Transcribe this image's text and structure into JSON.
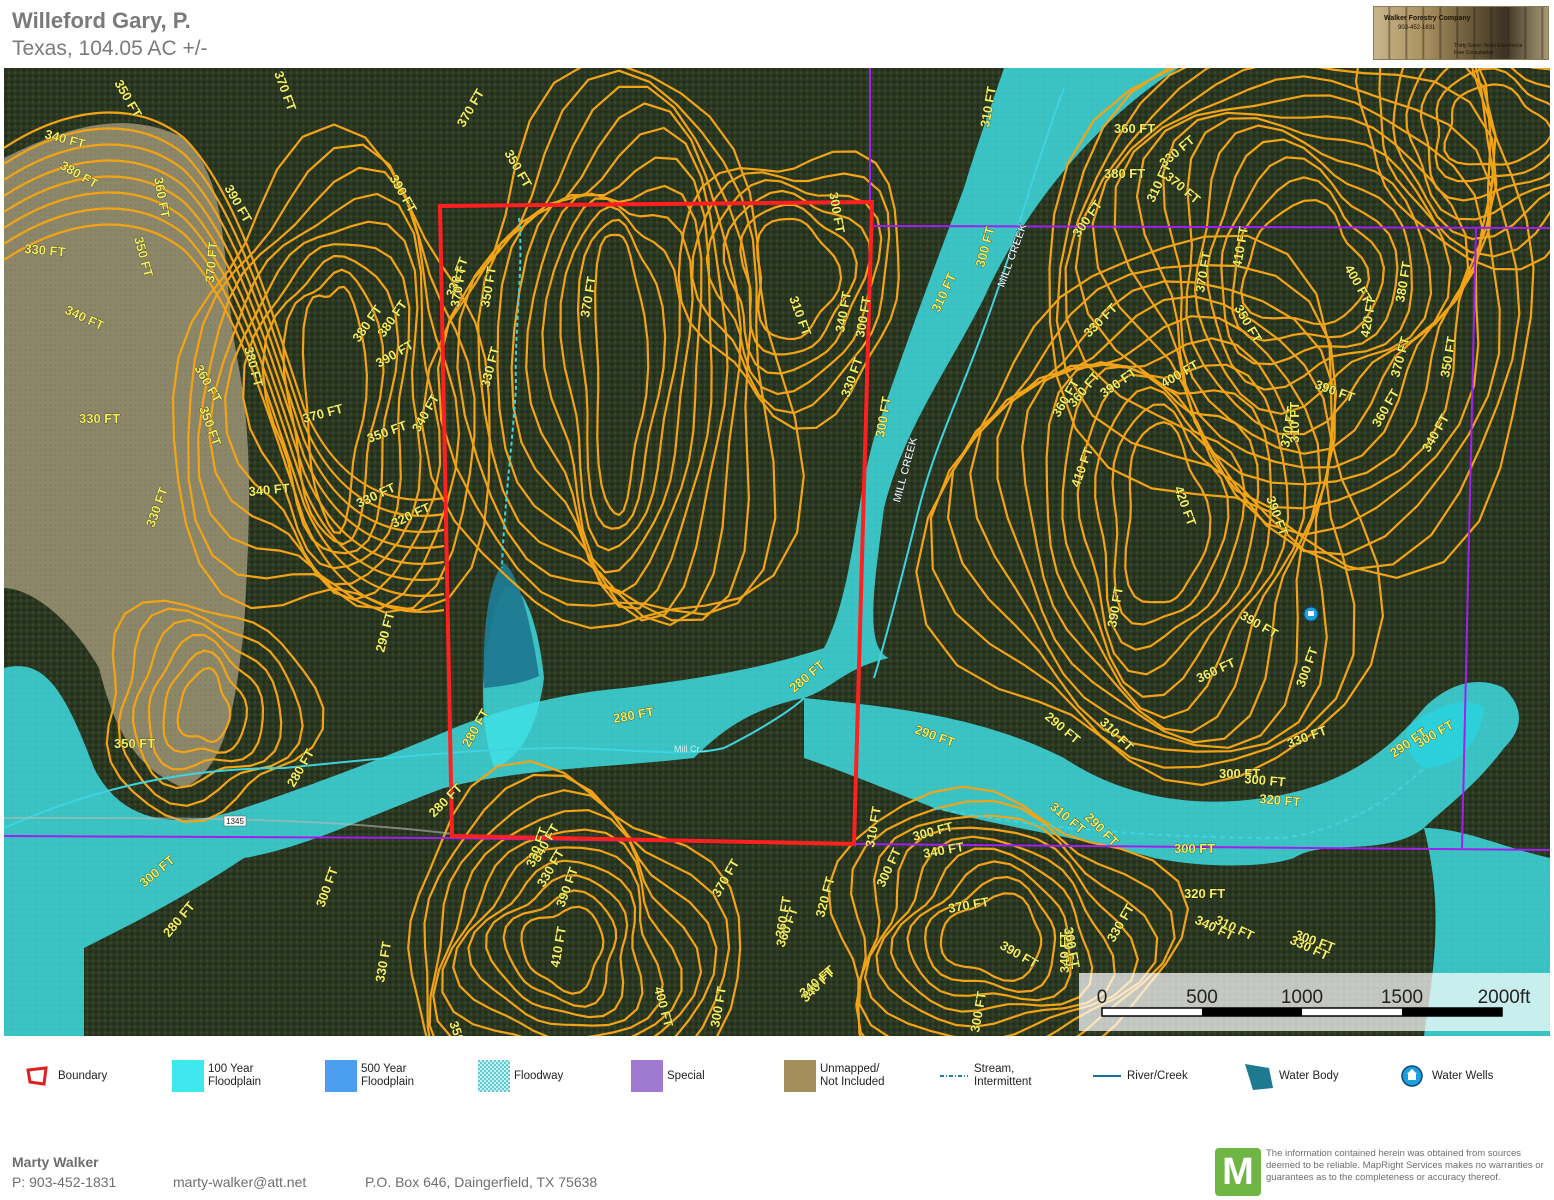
{
  "header": {
    "title": "Willeford Gary, P.",
    "subtitle": "Texas, 104.05 AC +/-",
    "logo": {
      "line1": "Walker Forestry Company",
      "line2": "903-452-1831",
      "line3": "Thirty Seven Years Experience",
      "line4": "Free Consultation"
    }
  },
  "map": {
    "colors": {
      "imagery_forest": "#2d3a22",
      "imagery_field": "#8a8566",
      "floodplain": "#3fe0e6",
      "contour": "#f2a416",
      "contour_label": "#f5f060",
      "boundary": "#ff2020",
      "parcel_line": "#a020f0",
      "water_body": "#1e8a9c",
      "stream": "#3fd3e0"
    },
    "contour_labels": [
      "350 FT",
      "340 FT",
      "380 FT",
      "360 FT",
      "350 FT",
      "330 FT",
      "340 FT",
      "370 FT",
      "380 FT",
      "390 FT",
      "360 FT",
      "350 FT",
      "380 FT",
      "390 FT",
      "370 FT",
      "330 FT",
      "350 FT",
      "340 FT",
      "340 FT",
      "330 FT",
      "320 FT",
      "330 FT",
      "370 FT",
      "350 FT",
      "390 FT",
      "370 FT",
      "350 FT",
      "330 FT",
      "370 FT",
      "380 FT",
      "350 FT",
      "330 FT",
      "370 FT",
      "310 FT",
      "340 FT",
      "330 FT",
      "300 FT",
      "310 FT",
      "300 FT",
      "310 FT",
      "300 FT",
      "360 FT",
      "380 FT",
      "370 FT",
      "350 FT",
      "310 FT",
      "330 FT",
      "330 FT",
      "360 FT",
      "410 FT",
      "370 FT",
      "400 FT",
      "420 FT",
      "380 FT",
      "370 FT",
      "390 FT",
      "410 FT",
      "390 FT",
      "400 FT",
      "360 FT",
      "420 FT",
      "390 FT",
      "370 FT",
      "340 FT",
      "360 FT",
      "350 FT",
      "390 FT",
      "360 FT",
      "390 FT",
      "300 FT",
      "310 FT",
      "300 FT",
      "300 FT",
      "280 FT",
      "280 FT",
      "280 FT",
      "280 FT",
      "290 FT",
      "290 FT",
      "310 FT",
      "330 FT",
      "290 FT",
      "300 FT",
      "300 FT",
      "300 FT",
      "310 FT",
      "290 FT",
      "300 FT",
      "300 FT",
      "320 FT",
      "310 FT",
      "300 FT",
      "290 FT",
      "280 FT",
      "300 FT",
      "280 FT",
      "300 FT",
      "320 FT",
      "330 FT",
      "390 FT",
      "340 FT",
      "370 FT",
      "360 FT",
      "320 FT",
      "340 FT",
      "310 FT",
      "300 FT",
      "340 FT",
      "370 FT",
      "360 FT",
      "390 FT",
      "320 FT",
      "340 FT",
      "330 FT",
      "320 FT",
      "340 FT",
      "330 FT",
      "330 FT",
      "410 FT",
      "400 FT",
      "340 FT",
      "350 FT",
      "300 FT",
      "360 FT",
      "300 FT"
    ],
    "stream_labels": [
      "MILL CREEK",
      "MILL CREEK",
      "Mill Cr..."
    ],
    "road_label": "1345",
    "scale_bar": {
      "ticks": [
        "0",
        "500",
        "1000",
        "1500",
        "2000ft"
      ]
    }
  },
  "legend": [
    {
      "label": "Boundary",
      "icon": "boundary-outline-icon",
      "color": "#e02020"
    },
    {
      "label": "100 Year\nFloodplain",
      "icon": "floodplain-100-swatch",
      "color": "#3fe7ee"
    },
    {
      "label": "500 Year\nFloodplain",
      "icon": "floodplain-500-swatch",
      "color": "#4b9ef0"
    },
    {
      "label": "Floodway",
      "icon": "floodway-hatch-swatch",
      "color": "#3fd3e0"
    },
    {
      "label": "Special",
      "icon": "special-swatch",
      "color": "#a07ad0"
    },
    {
      "label": "Unmapped/\nNot Included",
      "icon": "unmapped-swatch",
      "color": "#a28f5a"
    },
    {
      "label": "Stream,\nIntermittent",
      "icon": "stream-dashed-icon",
      "color": "#1a7fb0"
    },
    {
      "label": "River/Creek",
      "icon": "river-line-icon",
      "color": "#1a6f9a"
    },
    {
      "label": "Water Body",
      "icon": "water-body-icon",
      "color": "#1e7a90"
    },
    {
      "label": "Water Wells",
      "icon": "water-well-icon",
      "color": "#1aa0e0"
    }
  ],
  "footer": {
    "agent_name": "Marty Walker",
    "phone": "P: 903-452-1831",
    "email": "marty-walker@att.net",
    "address": "P.O. Box 646, Daingerfield, TX 75638",
    "brand_letter": "M",
    "disclaimer": "The information contained herein was obtained from sources deemed to be reliable. MapRight Services makes no warranties or guarantees as to the completeness or accuracy thereof."
  }
}
